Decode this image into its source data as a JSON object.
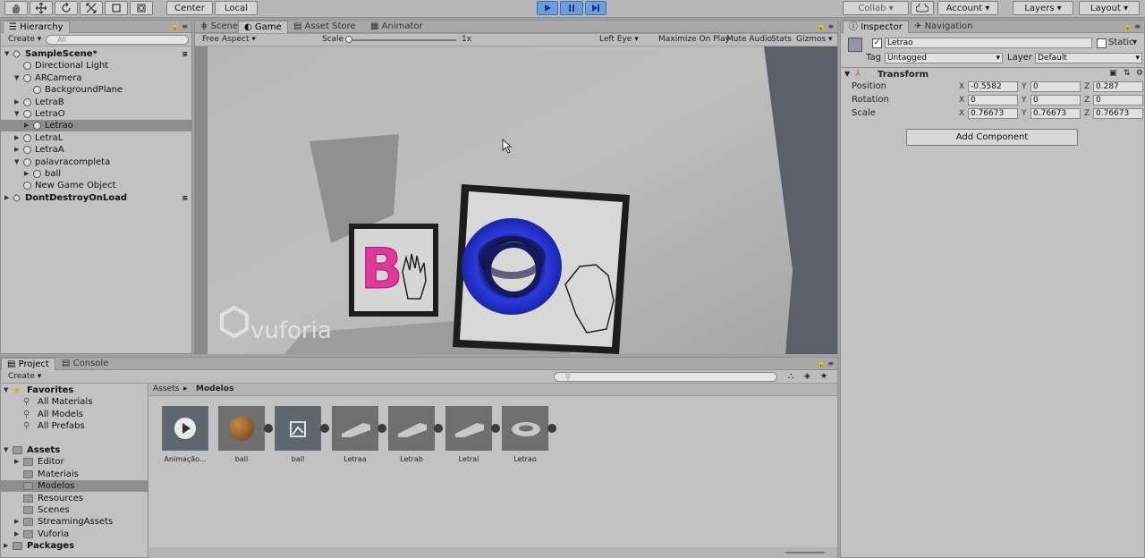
{
  "toolbar": {
    "tools": [
      "hand-icon",
      "move-icon",
      "rotate-icon",
      "scale-icon",
      "rect-tool-icon",
      "transform-tool-icon"
    ],
    "pivot": "Center",
    "space": "Local",
    "collab": "Collab",
    "account": "Account",
    "layers": "Layers",
    "layout": "Layout"
  },
  "hierarchy": {
    "tab": "Hierarchy",
    "create": "Create",
    "search_placeholder": "All",
    "items": [
      {
        "label": "SampleScene*",
        "depth": 0,
        "expanded": true,
        "scene": true
      },
      {
        "label": "Directional Light",
        "depth": 1
      },
      {
        "label": "ARCamera",
        "depth": 1,
        "expanded": true
      },
      {
        "label": "BackgroundPlane",
        "depth": 2
      },
      {
        "label": "LetraB",
        "depth": 1,
        "collapsed": true
      },
      {
        "label": "LetraO",
        "depth": 1,
        "expanded": true
      },
      {
        "label": "Letrao",
        "depth": 2,
        "collapsed": true,
        "selected": true
      },
      {
        "label": "LetraL",
        "depth": 1,
        "collapsed": true
      },
      {
        "label": "LetraA",
        "depth": 1,
        "collapsed": true
      },
      {
        "label": "palavracompleta",
        "depth": 1,
        "expanded": true
      },
      {
        "label": "ball",
        "depth": 2,
        "collapsed": true
      },
      {
        "label": "New Game Object",
        "depth": 1
      },
      {
        "label": "DontDestroyOnLoad",
        "depth": 0,
        "collapsed": true,
        "scene": true
      }
    ]
  },
  "center": {
    "tabs": [
      "Scene",
      "Game",
      "Asset Store",
      "Animator"
    ],
    "active_tab": "Game",
    "aspect": "Free Aspect",
    "scale_label": "Scale",
    "scale_value": "1x",
    "options": [
      "Left Eye",
      "Maximize On Play",
      "Mute Audio",
      "Stats",
      "Gizmos"
    ],
    "scale_fraction": 0.0
  },
  "game": {
    "letter_b": "B",
    "watermark": "vuforia",
    "colors": {
      "b": "#e0379a",
      "o": "#2a37d9"
    }
  },
  "inspector": {
    "tabs": [
      "Inspector",
      "Navigation"
    ],
    "object_name": "Letrao",
    "static_label": "Static",
    "tag_label": "Tag",
    "tag_value": "Untagged",
    "layer_label": "Layer",
    "layer_value": "Default",
    "transform_label": "Transform",
    "rows": [
      {
        "label": "Position",
        "x": "-0.5582",
        "y": "0",
        "z": "0.287"
      },
      {
        "label": "Rotation",
        "x": "0",
        "y": "0",
        "z": "0"
      },
      {
        "label": "Scale",
        "x": "0.76673",
        "y": "0.76673",
        "z": "0.76673"
      }
    ],
    "add_component": "Add Component"
  },
  "project": {
    "tabs": [
      "Project",
      "Console"
    ],
    "create": "Create",
    "favorites": {
      "label": "Favorites",
      "items": [
        "All Materials",
        "All Models",
        "All Prefabs"
      ]
    },
    "assets": {
      "label": "Assets",
      "items": [
        {
          "label": "Editor",
          "collapsed": true
        },
        {
          "label": "Materiais"
        },
        {
          "label": "Modelos",
          "selected": true
        },
        {
          "label": "Resources"
        },
        {
          "label": "Scenes"
        },
        {
          "label": "StreamingAssets",
          "collapsed": true
        },
        {
          "label": "Vuforia",
          "collapsed": true
        }
      ]
    },
    "packages": "Packages",
    "breadcrumb": [
      "Assets",
      "Modelos"
    ],
    "grid": [
      {
        "label": "Animação...",
        "icon": "animation-clip-icon"
      },
      {
        "label": "ball",
        "icon": "sphere-model-icon"
      },
      {
        "label": "ball",
        "icon": "prefab-icon"
      },
      {
        "label": "Letraa",
        "icon": "letter-model-icon"
      },
      {
        "label": "Letrab",
        "icon": "letter-model-icon"
      },
      {
        "label": "Letral",
        "icon": "letter-model-icon"
      },
      {
        "label": "Letrao",
        "icon": "ring-model-icon"
      }
    ]
  }
}
